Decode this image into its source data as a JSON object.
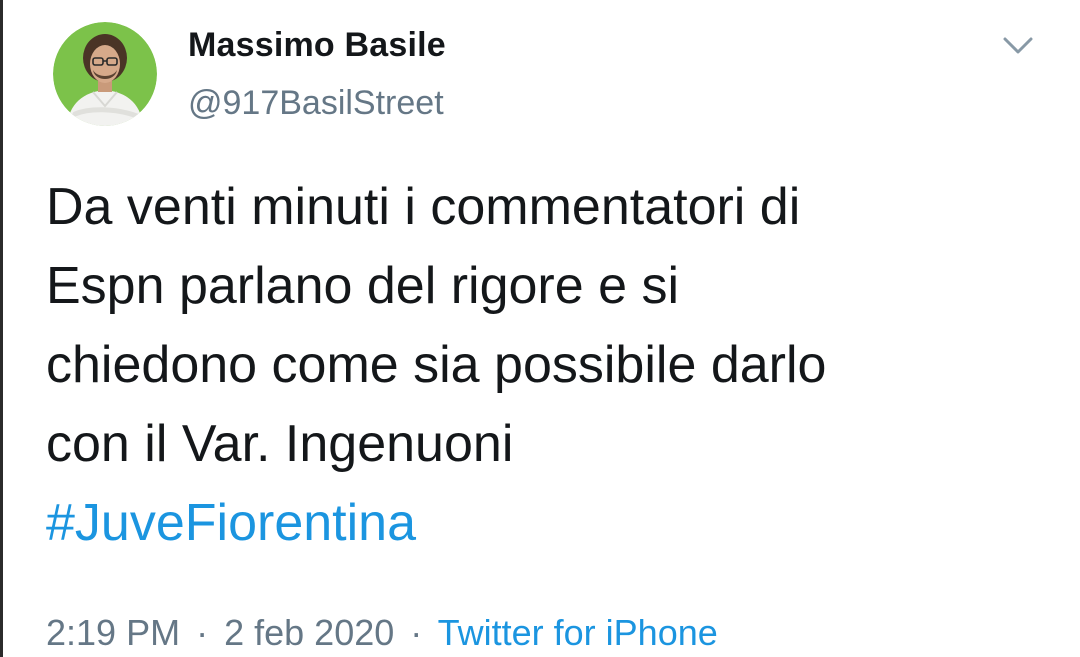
{
  "tweet": {
    "author": {
      "display_name": "Massimo Basile",
      "handle": "@917BasilStreet",
      "avatar_icon": "profile-photo"
    },
    "menu_icon": "chevron-down-icon",
    "text_lines": [
      "Da venti minuti i commentatori di",
      "Espn parlano del rigore e si",
      "chiedono come sia possibile darlo",
      "con il Var. Ingenuoni"
    ],
    "hashtag": "#JuveFiorentina",
    "time": "2:19 PM",
    "separator": "·",
    "date": "2 feb 2020",
    "source": "Twitter for iPhone"
  },
  "colors": {
    "text": "#14171a",
    "secondary": "#657786",
    "link": "#1b95e0",
    "avatar_bg": "#7cc24a"
  }
}
